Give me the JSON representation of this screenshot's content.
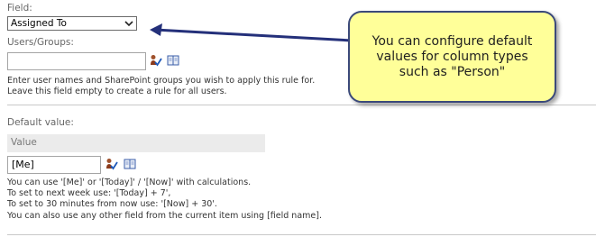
{
  "field": {
    "label": "Field:",
    "selected": "Assigned To"
  },
  "users": {
    "label": "Users/Groups:",
    "value": "",
    "help_line1": "Enter user names and SharePoint groups you wish to apply this rule for.",
    "help_line2": "Leave this field empty to create a rule for all users."
  },
  "default_value": {
    "label": "Default value:",
    "column_header": "Value",
    "value": "[Me]",
    "help": [
      "You can use '[Me]' or '[Today]' / '[Now]' with calculations.",
      "To set to next week use: '[Today] + 7',",
      "To set to 30 minutes from now use: '[Now] + 30'.",
      " You can also use any other field from the current item using [field name]."
    ]
  },
  "callout": {
    "line1": "You can configure default",
    "line2": "values for column types",
    "line3": "such as \"Person\""
  },
  "icons": {
    "check_names": "check-names-icon",
    "browse": "address-book-icon"
  },
  "colors": {
    "callout_fill": "#ffff99",
    "callout_border": "#3a4a7a",
    "arrow": "#24307a"
  }
}
